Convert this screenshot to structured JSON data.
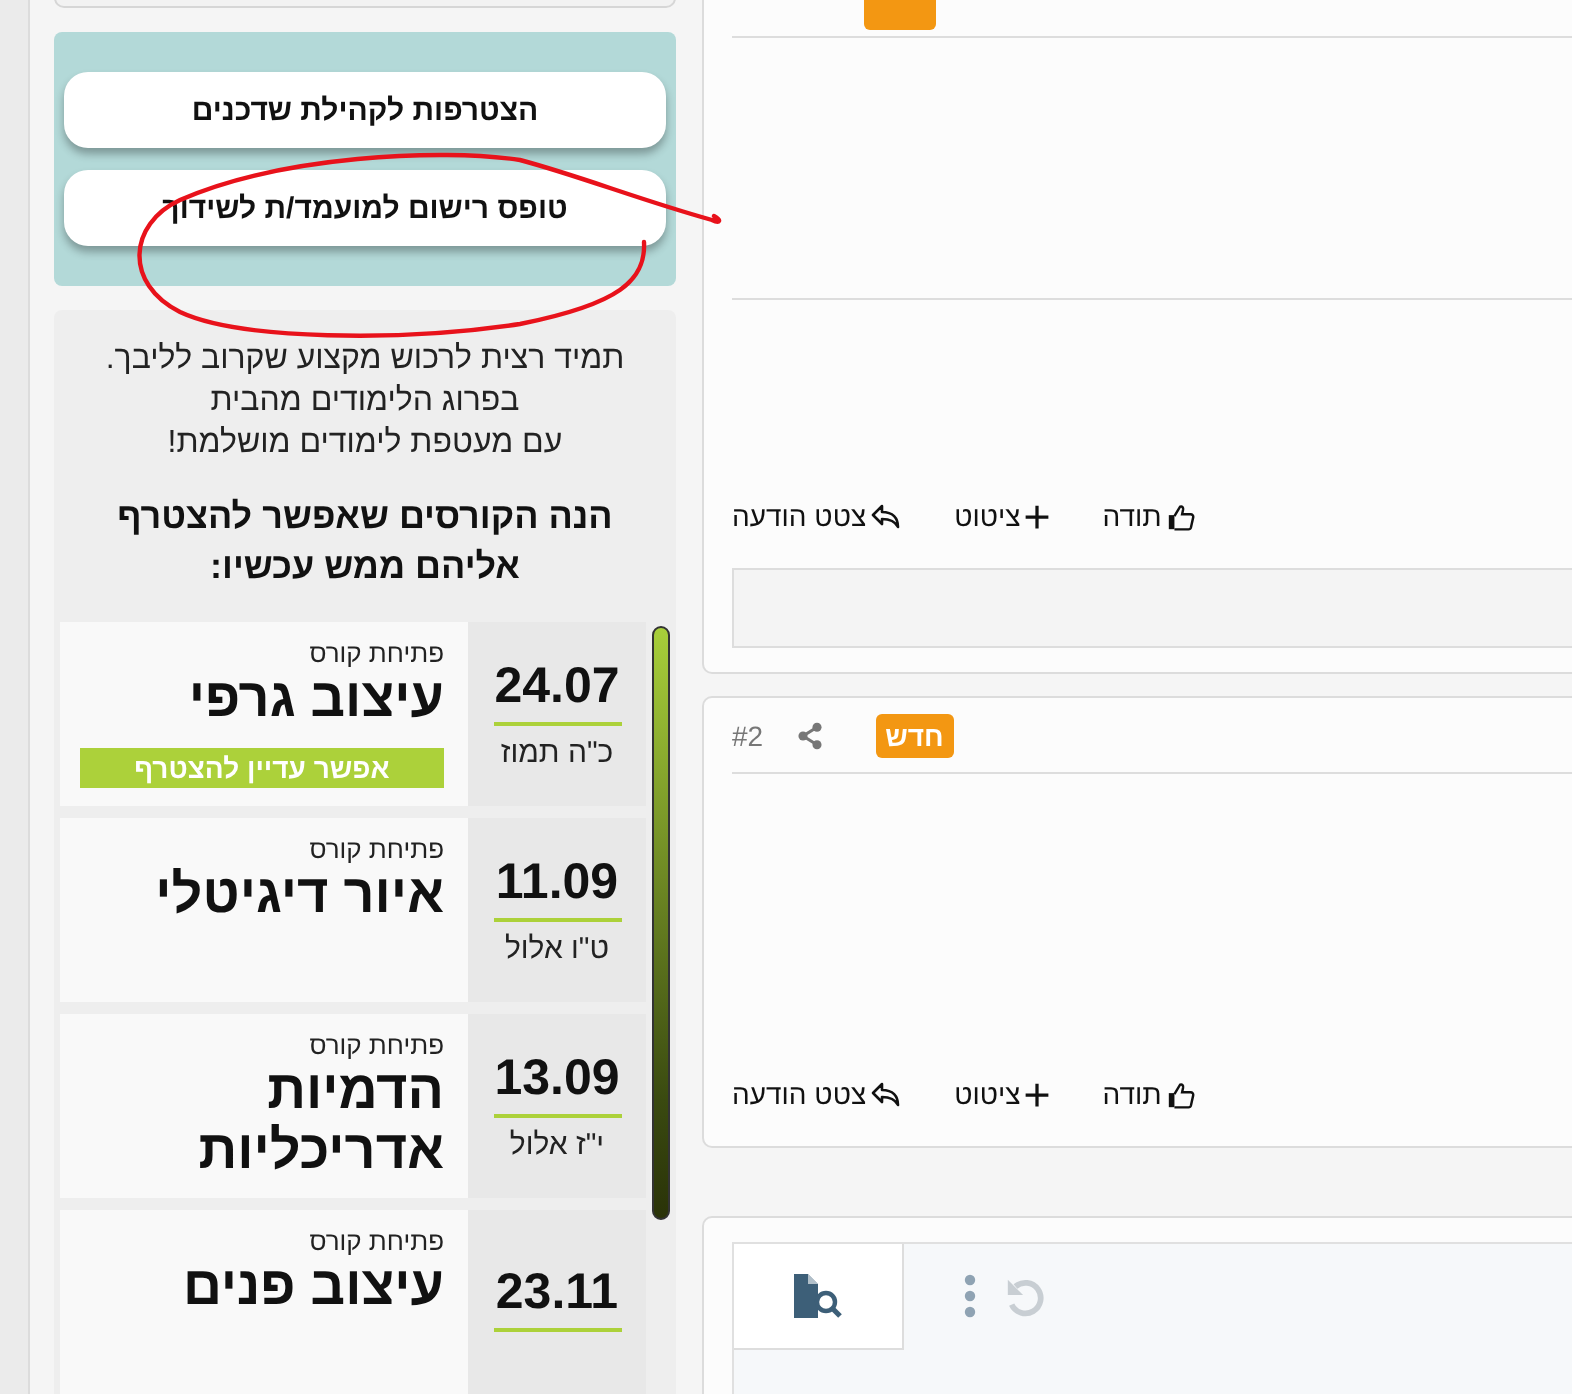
{
  "sidebar": {
    "buttons": [
      {
        "label": "הצטרפות לקהילת שדכנים"
      },
      {
        "label": "טופס רישום למועמד/ת לשידוך"
      }
    ],
    "promo": {
      "lines": [
        "תמיד רצית לרכוש מקצוע שקרוב לליבך.",
        "בפרוג הלימודים מהבית",
        "עם מעטפת לימודים מושלמת!"
      ],
      "heading_lines": [
        "הנה הקורסים שאפשר להצטרף",
        "אליהם ממש עכשיו:"
      ]
    },
    "courses": [
      {
        "label": "פתיחת קורס",
        "title": "עיצוב גרפי",
        "date": "24.07",
        "hebrew_date": "כ\"ה תמוז",
        "status": "אפשר עדיין להצטרף"
      },
      {
        "label": "פתיחת קורס",
        "title": "איור דיגיטלי",
        "date": "11.09",
        "hebrew_date": "ט\"ו אלול"
      },
      {
        "label": "פתיחת קורס",
        "title": "הדמיות אדריכליות",
        "date": "13.09",
        "hebrew_date": "י\"ז אלול"
      },
      {
        "label": "פתיחת קורס",
        "title": "עיצוב פנים",
        "date": "23.11"
      }
    ]
  },
  "posts": [
    {
      "kind": "cut",
      "actions": [
        {
          "kind": "like",
          "label": "תודה"
        },
        {
          "kind": "quote",
          "label": "ציטוט"
        },
        {
          "kind": "reply",
          "label": "צטט הודעה"
        }
      ],
      "reply_box": true
    },
    {
      "kind": "full",
      "number": "#2",
      "badge": "חדש",
      "actions": [
        {
          "kind": "like",
          "label": "תודה"
        },
        {
          "kind": "quote",
          "label": "ציטוט"
        },
        {
          "kind": "reply",
          "label": "צטט הודעה"
        }
      ],
      "reply_box": false
    }
  ],
  "editor": {
    "undo_disabled": true
  }
}
